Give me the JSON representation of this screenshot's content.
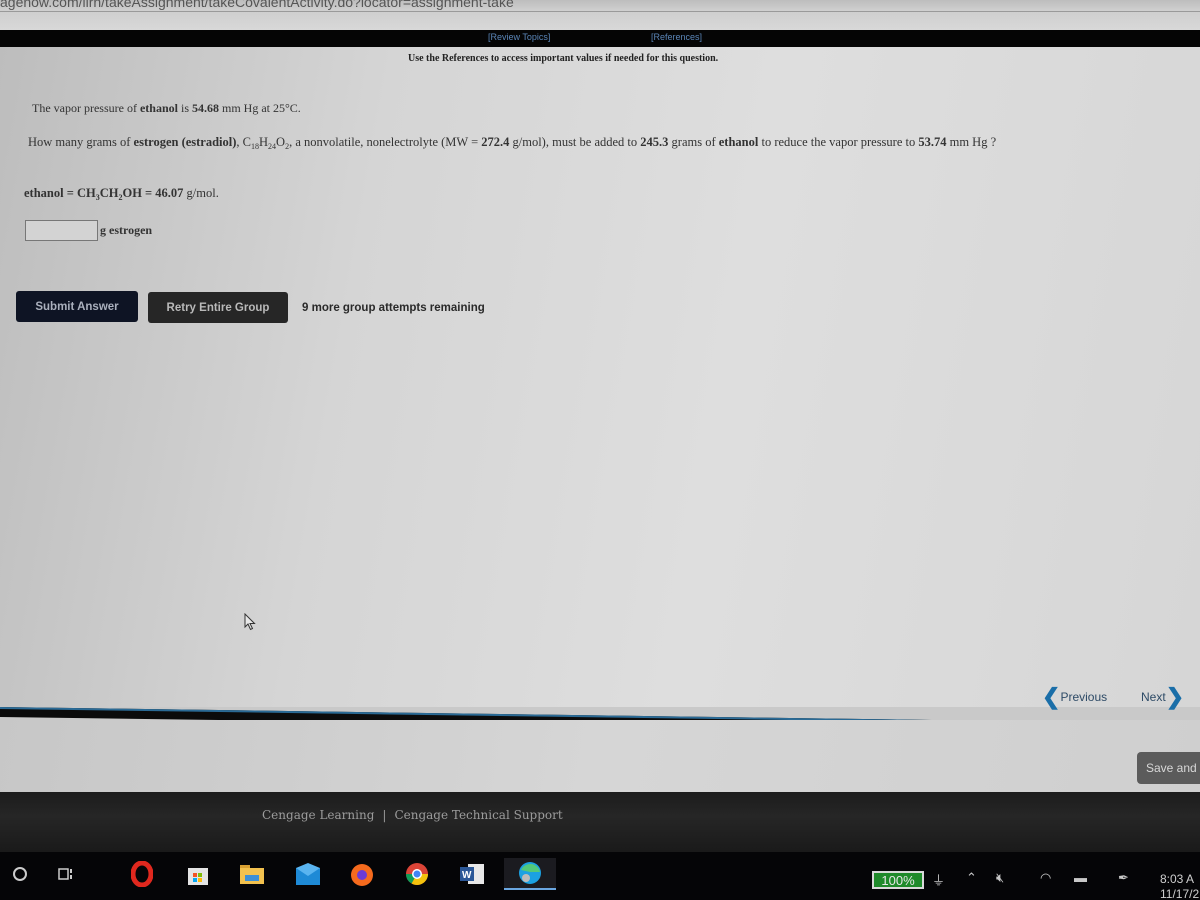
{
  "browser": {
    "url": "agenow.com/ilrn/takeAssignment/takeCovalentActivity.do?locator=assignment-take"
  },
  "reference_bar": {
    "review_topics": "[Review Topics]",
    "references": "[References]"
  },
  "question": {
    "use_references_note": "Use the References to access important values if needed for this question.",
    "line1": {
      "prefix": "The vapor pressure of ",
      "substance": "ethanol",
      "mid": " is ",
      "pressure": "54.68",
      "suffix": " mm Hg at 25°C."
    },
    "line2": {
      "a": "How many grams of ",
      "solute": "estrogen (estradiol)",
      "b": ", ",
      "formula_c": "C",
      "formula_c_sub": "18",
      "formula_h": "H",
      "formula_h_sub": "24",
      "formula_o": "O",
      "formula_o_sub": "2",
      "c": ", a nonvolatile, nonelectrolyte (MW = ",
      "mw": "272.4",
      "d": " g/mol), must be added to ",
      "mass": "245.3",
      "e": " grams of ",
      "solvent": "ethanol",
      "f": " to reduce the vapor pressure to ",
      "target_pressure": "53.74",
      "g": " mm Hg ?"
    },
    "line3": {
      "label": "ethanol = CH",
      "sub1": "3",
      "mid": "CH",
      "sub2": "2",
      "rest": "OH = 46.07",
      "unit": " g/mol."
    },
    "answer": {
      "value": "",
      "unit": "g estrogen"
    }
  },
  "actions": {
    "submit": "Submit Answer",
    "retry": "Retry Entire Group",
    "attempts_remaining": "9 more group attempts remaining"
  },
  "navigation": {
    "previous": "Previous",
    "next": "Next",
    "save": "Save and"
  },
  "footer": {
    "company": "Cengage Learning",
    "separator": "|",
    "support": "Cengage Technical Support"
  },
  "taskbar": {
    "apps": [
      "search",
      "task-view",
      "opera",
      "store",
      "file-explorer",
      "mail",
      "firefox",
      "chrome",
      "word",
      "edge"
    ],
    "battery": "100%",
    "time": "8:03 A",
    "date": "11/17/2"
  },
  "colors": {
    "link": "#5b86b8",
    "nav_chevron": "#1a6ea8",
    "submit_bg": "#0e1424",
    "retry_bg": "#262626",
    "battery": "#1f8a2a"
  }
}
